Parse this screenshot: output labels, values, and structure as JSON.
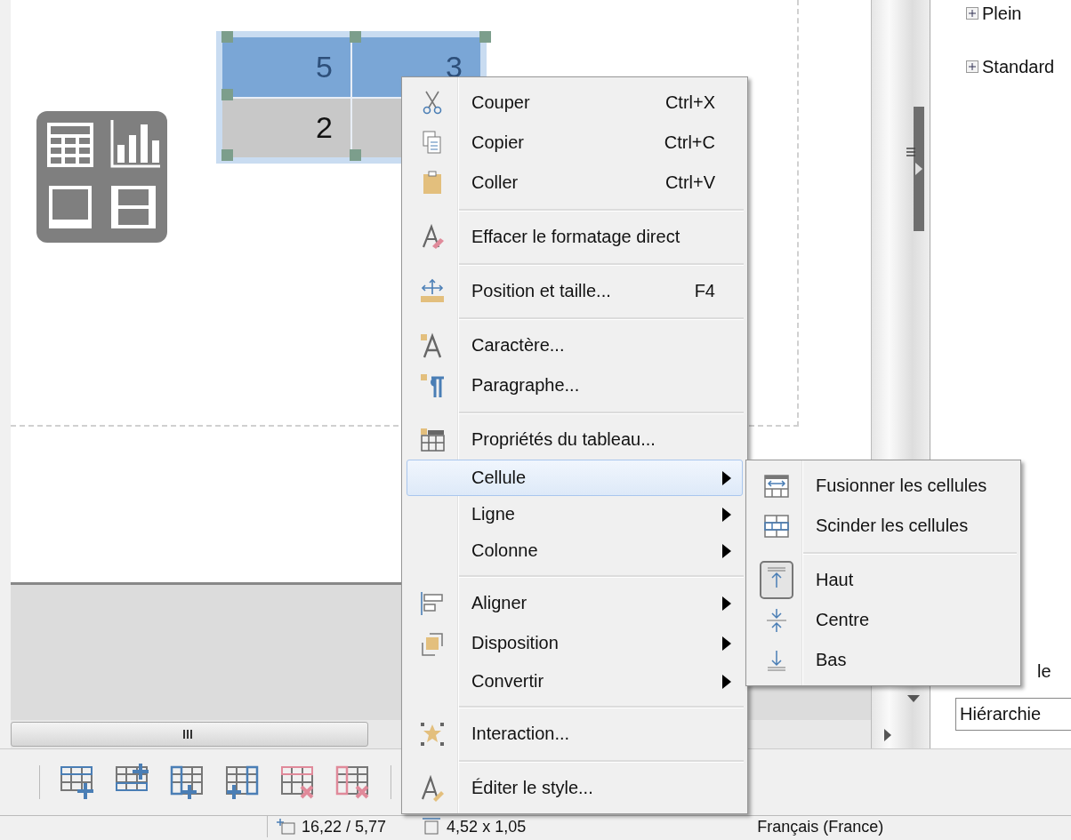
{
  "slide_table": {
    "rows": [
      {
        "selected": true,
        "cells": [
          "5",
          "3"
        ]
      },
      {
        "selected": false,
        "cells": [
          "2"
        ]
      }
    ]
  },
  "sidebar": {
    "items": [
      {
        "label": "Plein",
        "expanded": false
      },
      {
        "label": "Standard",
        "expanded": false
      }
    ],
    "cut_label": "le",
    "view_select": {
      "value": "Hiérarchie"
    }
  },
  "context_menu": {
    "items": [
      {
        "kind": "item",
        "label": "Couper",
        "shortcut": "Ctrl+X",
        "submenu": false,
        "selected": false
      },
      {
        "kind": "item",
        "label": "Copier",
        "shortcut": "Ctrl+C",
        "submenu": false,
        "selected": false
      },
      {
        "kind": "item",
        "label": "Coller",
        "shortcut": "Ctrl+V",
        "submenu": false,
        "selected": false
      },
      {
        "kind": "separator"
      },
      {
        "kind": "item",
        "label": "Effacer le formatage direct",
        "submenu": false,
        "selected": false
      },
      {
        "kind": "separator"
      },
      {
        "kind": "item",
        "label": "Position et taille...",
        "shortcut": "F4",
        "submenu": false,
        "selected": false
      },
      {
        "kind": "separator"
      },
      {
        "kind": "item",
        "label": "Caractère...",
        "submenu": false,
        "selected": false
      },
      {
        "kind": "item",
        "label": "Paragraphe...",
        "submenu": false,
        "selected": false
      },
      {
        "kind": "separator"
      },
      {
        "kind": "item",
        "label": "Propriétés du tableau...",
        "submenu": false,
        "selected": false
      },
      {
        "kind": "item",
        "label": "Cellule",
        "submenu": true,
        "selected": true
      },
      {
        "kind": "item",
        "label": "Ligne",
        "submenu": true,
        "selected": false
      },
      {
        "kind": "item",
        "label": "Colonne",
        "submenu": true,
        "selected": false
      },
      {
        "kind": "separator"
      },
      {
        "kind": "item",
        "label": "Aligner",
        "submenu": true,
        "selected": false
      },
      {
        "kind": "item",
        "label": "Disposition",
        "submenu": true,
        "selected": false
      },
      {
        "kind": "item",
        "label": "Convertir",
        "submenu": true,
        "selected": false
      },
      {
        "kind": "separator"
      },
      {
        "kind": "item",
        "label": "Interaction...",
        "submenu": false,
        "selected": false
      },
      {
        "kind": "separator"
      },
      {
        "kind": "item",
        "label": "Éditer le style...",
        "submenu": false,
        "selected": false
      }
    ]
  },
  "cell_submenu": {
    "items": [
      {
        "kind": "item",
        "label": "Fusionner les cellules",
        "checked": false
      },
      {
        "kind": "item",
        "label": "Scinder les cellules",
        "checked": false
      },
      {
        "kind": "separator"
      },
      {
        "kind": "item",
        "label": "Haut",
        "checked": true
      },
      {
        "kind": "item",
        "label": "Centre",
        "checked": false
      },
      {
        "kind": "item",
        "label": "Bas",
        "checked": false
      }
    ]
  },
  "status_bar": {
    "position": "16,22 / 5,77",
    "size": "4,52 x 1,05",
    "language": "Français (France)"
  }
}
